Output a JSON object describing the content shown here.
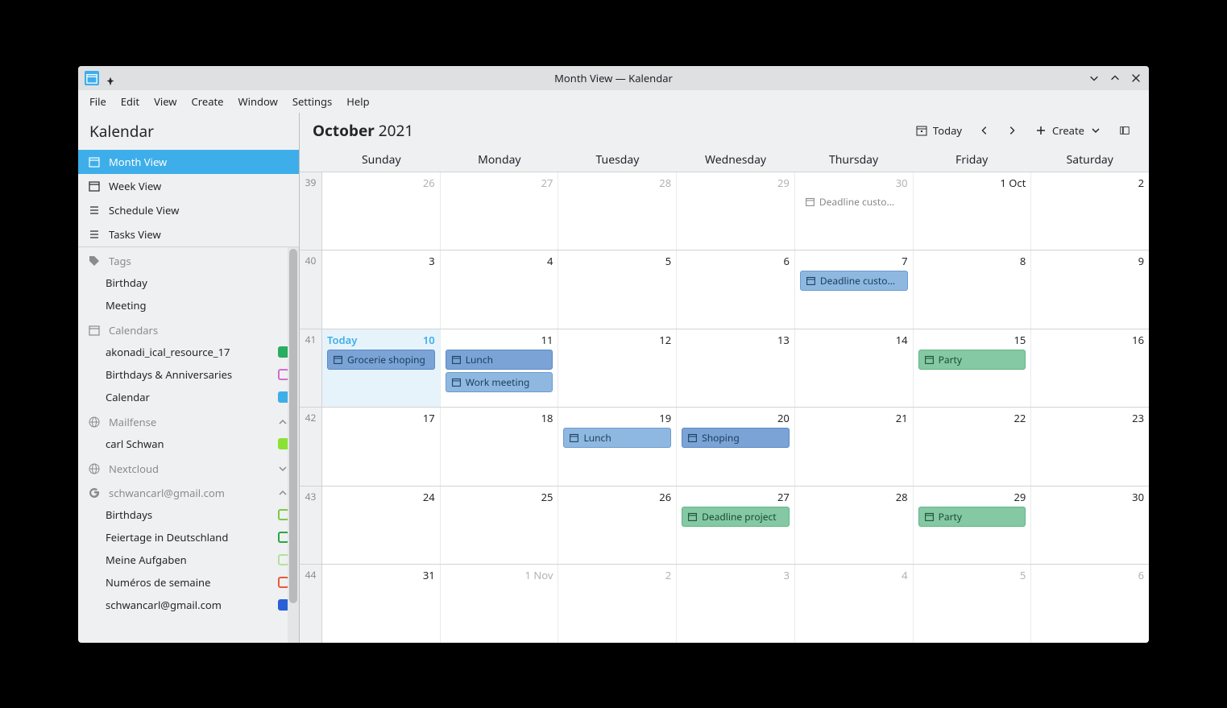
{
  "window": {
    "title": "Month View — Kalendar"
  },
  "menubar": [
    "File",
    "Edit",
    "View",
    "Create",
    "Window",
    "Settings",
    "Help"
  ],
  "sidebar": {
    "title": "Kalendar",
    "views": [
      {
        "label": "Month View",
        "active": true
      },
      {
        "label": "Week View",
        "active": false
      },
      {
        "label": "Schedule View",
        "active": false
      },
      {
        "label": "Tasks View",
        "active": false
      }
    ],
    "tags": {
      "header": "Tags",
      "items": [
        "Birthday",
        "Meeting"
      ]
    },
    "calendars": {
      "header": "Calendars",
      "items": [
        {
          "label": "akonadi_ical_resource_17",
          "color": "#27ae60",
          "filled": true
        },
        {
          "label": "Birthdays & Anniversaries",
          "color": "#d26cd2",
          "filled": false
        },
        {
          "label": "Calendar",
          "color": "#3daee9",
          "filled": true
        }
      ]
    },
    "accounts": [
      {
        "header": "Mailfense",
        "expanded": true,
        "items": [
          {
            "label": "carl Schwan",
            "color": "#8ae234",
            "filled": true
          }
        ]
      },
      {
        "header": "Nextcloud",
        "expanded": false,
        "items": []
      },
      {
        "header": "schwancarl@gmail.com",
        "expanded": true,
        "items": [
          {
            "label": "Birthdays",
            "color": "#7cc946",
            "filled": false
          },
          {
            "label": "Feiertage in Deutschland",
            "color": "#2aa745",
            "filled": false
          },
          {
            "label": "Meine Aufgaben",
            "color": "#b5e099",
            "filled": false
          },
          {
            "label": "Numéros de semaine",
            "color": "#e95a3d",
            "filled": false
          },
          {
            "label": "schwancarl@gmail.com",
            "color": "#2a5fd8",
            "filled": true
          }
        ]
      }
    ]
  },
  "main": {
    "month": "October",
    "year": "2021",
    "today_btn": "Today",
    "create_btn": "Create",
    "today_label": "Today",
    "day_headers": [
      "Sunday",
      "Monday",
      "Tuesday",
      "Wednesday",
      "Thursday",
      "Friday",
      "Saturday"
    ],
    "weeks": [
      {
        "num": "39",
        "days": [
          {
            "n": "26",
            "other": true
          },
          {
            "n": "27",
            "other": true
          },
          {
            "n": "28",
            "other": true
          },
          {
            "n": "29",
            "other": true
          },
          {
            "n": "30",
            "other": true,
            "events": [
              {
                "text": "Deadline custo…",
                "cls": "grey"
              }
            ]
          },
          {
            "n": "1 Oct"
          },
          {
            "n": "2"
          }
        ]
      },
      {
        "num": "40",
        "days": [
          {
            "n": "3"
          },
          {
            "n": "4"
          },
          {
            "n": "5"
          },
          {
            "n": "6"
          },
          {
            "n": "7",
            "events": [
              {
                "text": "Deadline custo…",
                "cls": "blue"
              }
            ]
          },
          {
            "n": "8"
          },
          {
            "n": "9"
          }
        ]
      },
      {
        "num": "41",
        "days": [
          {
            "n": "10",
            "today": true,
            "events": [
              {
                "text": "Grocerie shoping",
                "cls": "blue-dark"
              }
            ]
          },
          {
            "n": "11",
            "events": [
              {
                "text": "Lunch",
                "cls": "blue-dark"
              },
              {
                "text": "Work meeting",
                "cls": "blue"
              }
            ]
          },
          {
            "n": "12"
          },
          {
            "n": "13"
          },
          {
            "n": "14"
          },
          {
            "n": "15",
            "events": [
              {
                "text": "Party",
                "cls": "green"
              }
            ]
          },
          {
            "n": "16"
          }
        ]
      },
      {
        "num": "42",
        "days": [
          {
            "n": "17"
          },
          {
            "n": "18"
          },
          {
            "n": "19",
            "events": [
              {
                "text": "Lunch",
                "cls": "blue"
              }
            ]
          },
          {
            "n": "20",
            "events": [
              {
                "text": "Shoping",
                "cls": "blue-dark"
              }
            ]
          },
          {
            "n": "21"
          },
          {
            "n": "22"
          },
          {
            "n": "23"
          }
        ]
      },
      {
        "num": "43",
        "days": [
          {
            "n": "24"
          },
          {
            "n": "25"
          },
          {
            "n": "26"
          },
          {
            "n": "27",
            "events": [
              {
                "text": "Deadline project",
                "cls": "green"
              }
            ]
          },
          {
            "n": "28"
          },
          {
            "n": "29",
            "events": [
              {
                "text": "Party",
                "cls": "green"
              }
            ]
          },
          {
            "n": "30"
          }
        ]
      },
      {
        "num": "44",
        "days": [
          {
            "n": "31"
          },
          {
            "n": "1 Nov",
            "other": true
          },
          {
            "n": "2",
            "other": true
          },
          {
            "n": "3",
            "other": true
          },
          {
            "n": "4",
            "other": true
          },
          {
            "n": "5",
            "other": true
          },
          {
            "n": "6",
            "other": true
          }
        ]
      }
    ]
  }
}
